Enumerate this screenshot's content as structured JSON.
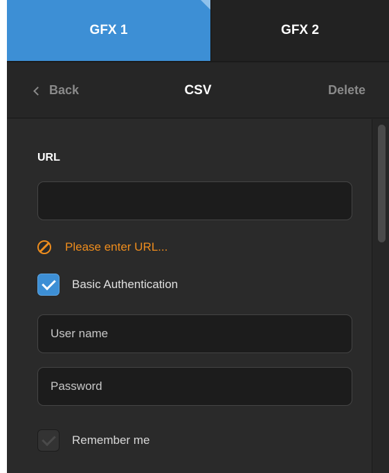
{
  "tabs": [
    {
      "label": "GFX 1",
      "active": true
    },
    {
      "label": "GFX 2",
      "active": false
    }
  ],
  "header": {
    "back_label": "Back",
    "title": "CSV",
    "delete_label": "Delete"
  },
  "form": {
    "url_label": "URL",
    "url_value": "",
    "url_placeholder": "",
    "error_message": "Please enter URL...",
    "basic_auth_label": "Basic Authentication",
    "basic_auth_checked": true,
    "username_placeholder": "User name",
    "username_value": "",
    "password_placeholder": "Password",
    "password_value": "",
    "remember_label": "Remember me",
    "remember_checked": true,
    "remember_enabled": false
  },
  "colors": {
    "accent": "#3d8fd5",
    "error": "#ef8d1d",
    "panel_bg": "#2a2a2a"
  },
  "icons": {
    "back": "chevron-left-icon",
    "error": "prohibited-icon",
    "check": "checkmark-icon"
  }
}
